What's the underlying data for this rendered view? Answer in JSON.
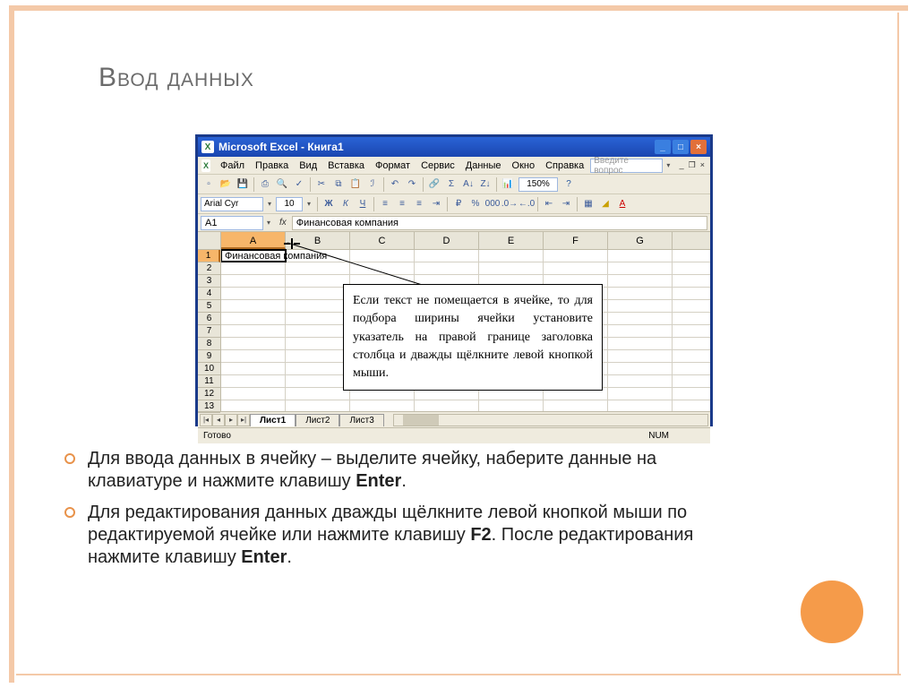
{
  "slide": {
    "title": "Ввод данных"
  },
  "excel": {
    "titlebar": "Microsoft Excel - Книга1",
    "menus": [
      "Файл",
      "Правка",
      "Вид",
      "Вставка",
      "Формат",
      "Сервис",
      "Данные",
      "Окно",
      "Справка"
    ],
    "help_placeholder": "Введите вопрос",
    "font_name": "Arial Cyr",
    "font_size": "10",
    "zoom": "150%",
    "namebox": "A1",
    "fx_label": "fx",
    "formula": "Финансовая компания",
    "columns": [
      "A",
      "B",
      "C",
      "D",
      "E",
      "F",
      "G"
    ],
    "rows": [
      "1",
      "2",
      "3",
      "4",
      "5",
      "6",
      "7",
      "8",
      "9",
      "10",
      "11",
      "12",
      "13"
    ],
    "cell_a1": "Финансовая компания",
    "sheet_tabs": [
      "Лист1",
      "Лист2",
      "Лист3"
    ],
    "status_ready": "Готово",
    "status_num": "NUM"
  },
  "callout": "Если текст не помещается в ячейке, то для подбора ширины ячейки установите указатель на правой границе заголовка столбца и дважды щёлкните левой кнопкой мыши.",
  "bullets": [
    {
      "pre": "Для ввода данных в ячейку – выделите ячейку, наберите данные на клавиатуре и нажмите клавишу ",
      "b1": "Enter",
      "post": "."
    },
    {
      "pre": "Для редактирования данных дважды щёлкните левой кнопкой мыши по редактируемой ячейке или нажмите клавишу ",
      "b1": "F2",
      "mid": ". После редактирования нажмите клавишу ",
      "b2": "Enter",
      "post": "."
    }
  ]
}
